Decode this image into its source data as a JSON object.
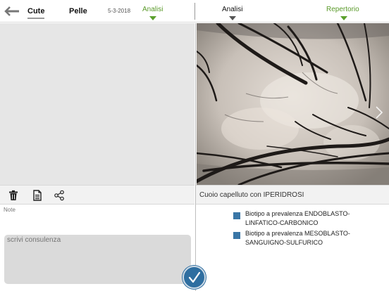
{
  "header": {
    "tabs": [
      {
        "label": "Cute",
        "active": true
      },
      {
        "label": "Pelle",
        "active": false
      }
    ],
    "date": "5-3-2018",
    "left_link": "Analisi",
    "right_tab": "Analisi",
    "repertorio_link": "Repertorio"
  },
  "left_panel": {
    "toolbar_icons": [
      "trash-icon",
      "document-icon",
      "share-icon"
    ],
    "note_label": "Note",
    "consult_placeholder": "scrivi consulenza"
  },
  "right_panel": {
    "photo_caption": "Cuoio capelluto con IPERIDROSI",
    "biotypes": [
      "Biotipo a prevalenza ENDOBLASTO-LINFATICO-CARBONICO",
      "Biotipo a prevalenza MESOBLASTO-SANGUIGNO-SULFURICO"
    ]
  },
  "colors": {
    "accent_green": "#5a9a2a",
    "confirm_blue": "#2e6ea0",
    "biotype_square": "#3a76a6"
  }
}
